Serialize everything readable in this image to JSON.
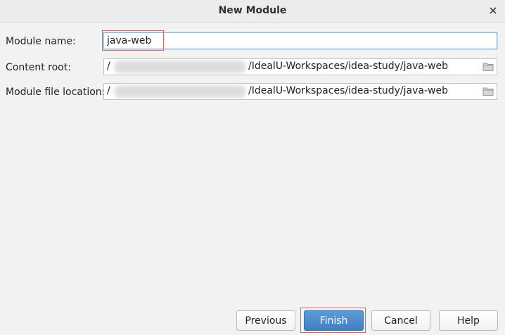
{
  "window": {
    "title": "New Module",
    "close_icon": "close-icon"
  },
  "form": {
    "module_name": {
      "label": "Module name:",
      "value": "java-web"
    },
    "content_root": {
      "label": "Content root:",
      "prefix": "/",
      "suffix": "/IdealU-Workspaces/idea-study/java-web"
    },
    "module_file_location": {
      "label": "Module file location:",
      "prefix": "/",
      "suffix": "/IdealU-Workspaces/idea-study/java-web"
    }
  },
  "buttons": {
    "previous": "Previous",
    "finish": "Finish",
    "cancel": "Cancel",
    "help": "Help"
  },
  "icons": {
    "browse": "folder-icon"
  },
  "colors": {
    "primary_button": "#4a89cc",
    "highlight_border": "#e06060",
    "focus_border": "#8fb3d9"
  }
}
